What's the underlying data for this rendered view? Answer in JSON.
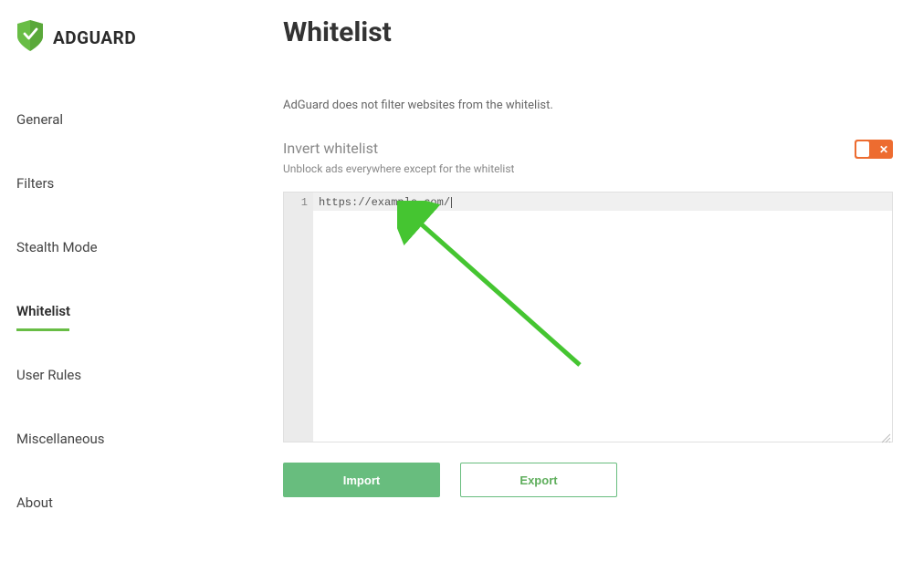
{
  "brand": {
    "name": "ADGUARD"
  },
  "sidebar": {
    "items": [
      {
        "label": "General"
      },
      {
        "label": "Filters"
      },
      {
        "label": "Stealth Mode"
      },
      {
        "label": "Whitelist"
      },
      {
        "label": "User Rules"
      },
      {
        "label": "Miscellaneous"
      },
      {
        "label": "About"
      }
    ],
    "activeIndex": 3
  },
  "page": {
    "title": "Whitelist",
    "description": "AdGuard does not filter websites from the whitelist."
  },
  "invert": {
    "title": "Invert whitelist",
    "description": "Unblock ads everywhere except for the whitelist",
    "enabled": false
  },
  "editor": {
    "lineNumber": "1",
    "content": "https://example.com/"
  },
  "buttons": {
    "import": "Import",
    "export": "Export"
  },
  "colors": {
    "accent": "#68bd45",
    "toggleOff": "#ed6c30"
  }
}
